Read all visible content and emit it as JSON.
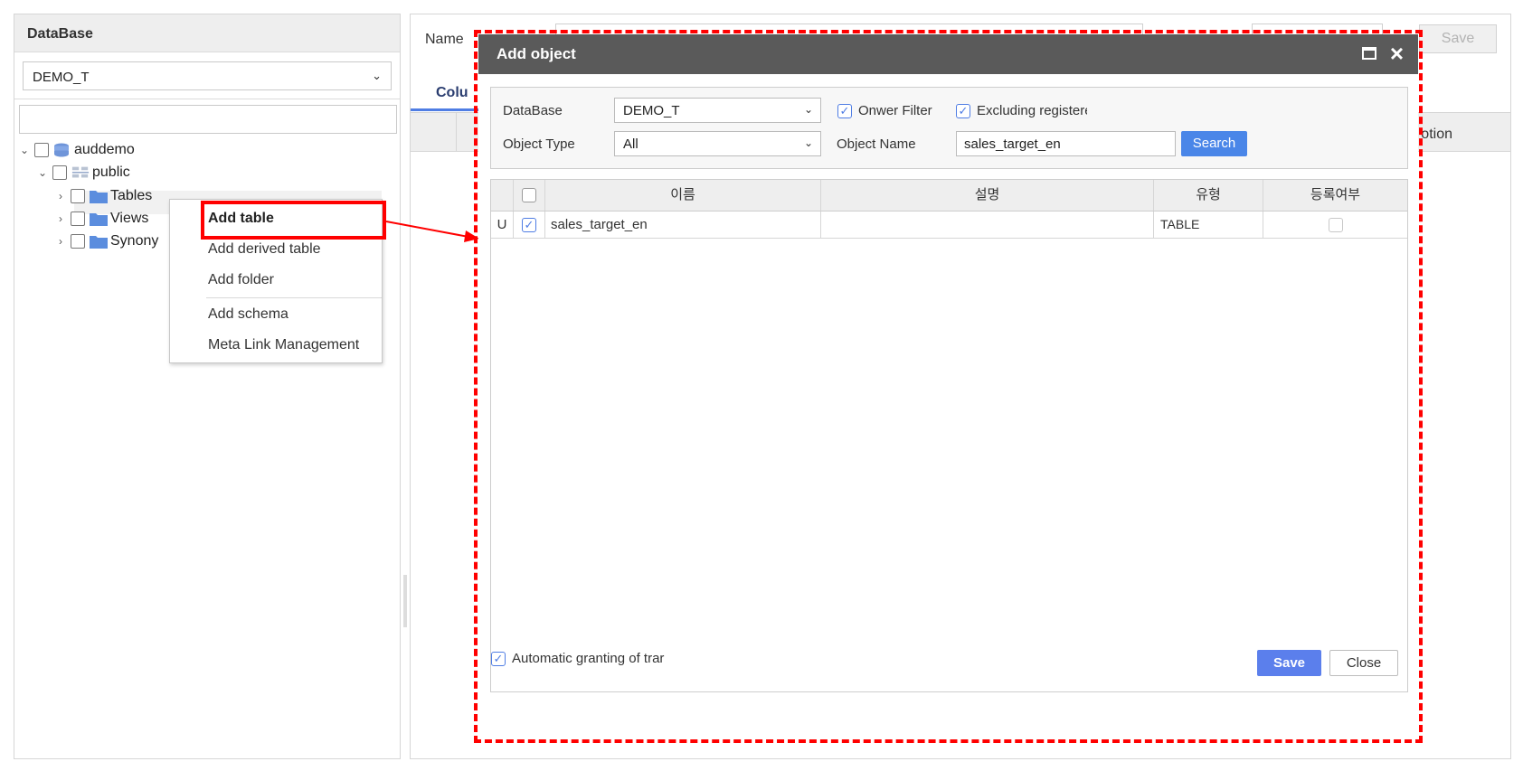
{
  "left_panel": {
    "title": "DataBase",
    "db_selected": "DEMO_T",
    "tree": {
      "root": "auddemo",
      "schema": "public",
      "children": [
        "Tables",
        "Views",
        "Synony"
      ]
    }
  },
  "context_menu": {
    "items": [
      "Add table",
      "Add derived table",
      "Add folder",
      "Add schema",
      "Meta Link Management"
    ]
  },
  "background": {
    "name_label": "Name",
    "save_label": "Save",
    "tab_label": "Colu",
    "header_option": "otion"
  },
  "dialog": {
    "title": "Add object",
    "filters": {
      "database_label": "DataBase",
      "database_value": "DEMO_T",
      "object_type_label": "Object Type",
      "object_type_value": "All",
      "owner_filter_label": "Onwer Filter",
      "excluding_label": "Excluding registere",
      "object_name_label": "Object Name",
      "object_name_value": "sales_target_en",
      "search_label": "Search"
    },
    "grid": {
      "columns": [
        "이름",
        "설명",
        "유형",
        "등록여부"
      ],
      "rows": [
        {
          "status": "U",
          "name": "sales_target_en",
          "description": "",
          "type": "TABLE"
        }
      ]
    },
    "auto_grant_label": "Automatic granting of trar",
    "save_label": "Save",
    "close_label": "Close"
  },
  "colors": {
    "highlight": "#ff0000",
    "accent": "#4a86e8",
    "title_bar": "#5a5a5a"
  }
}
